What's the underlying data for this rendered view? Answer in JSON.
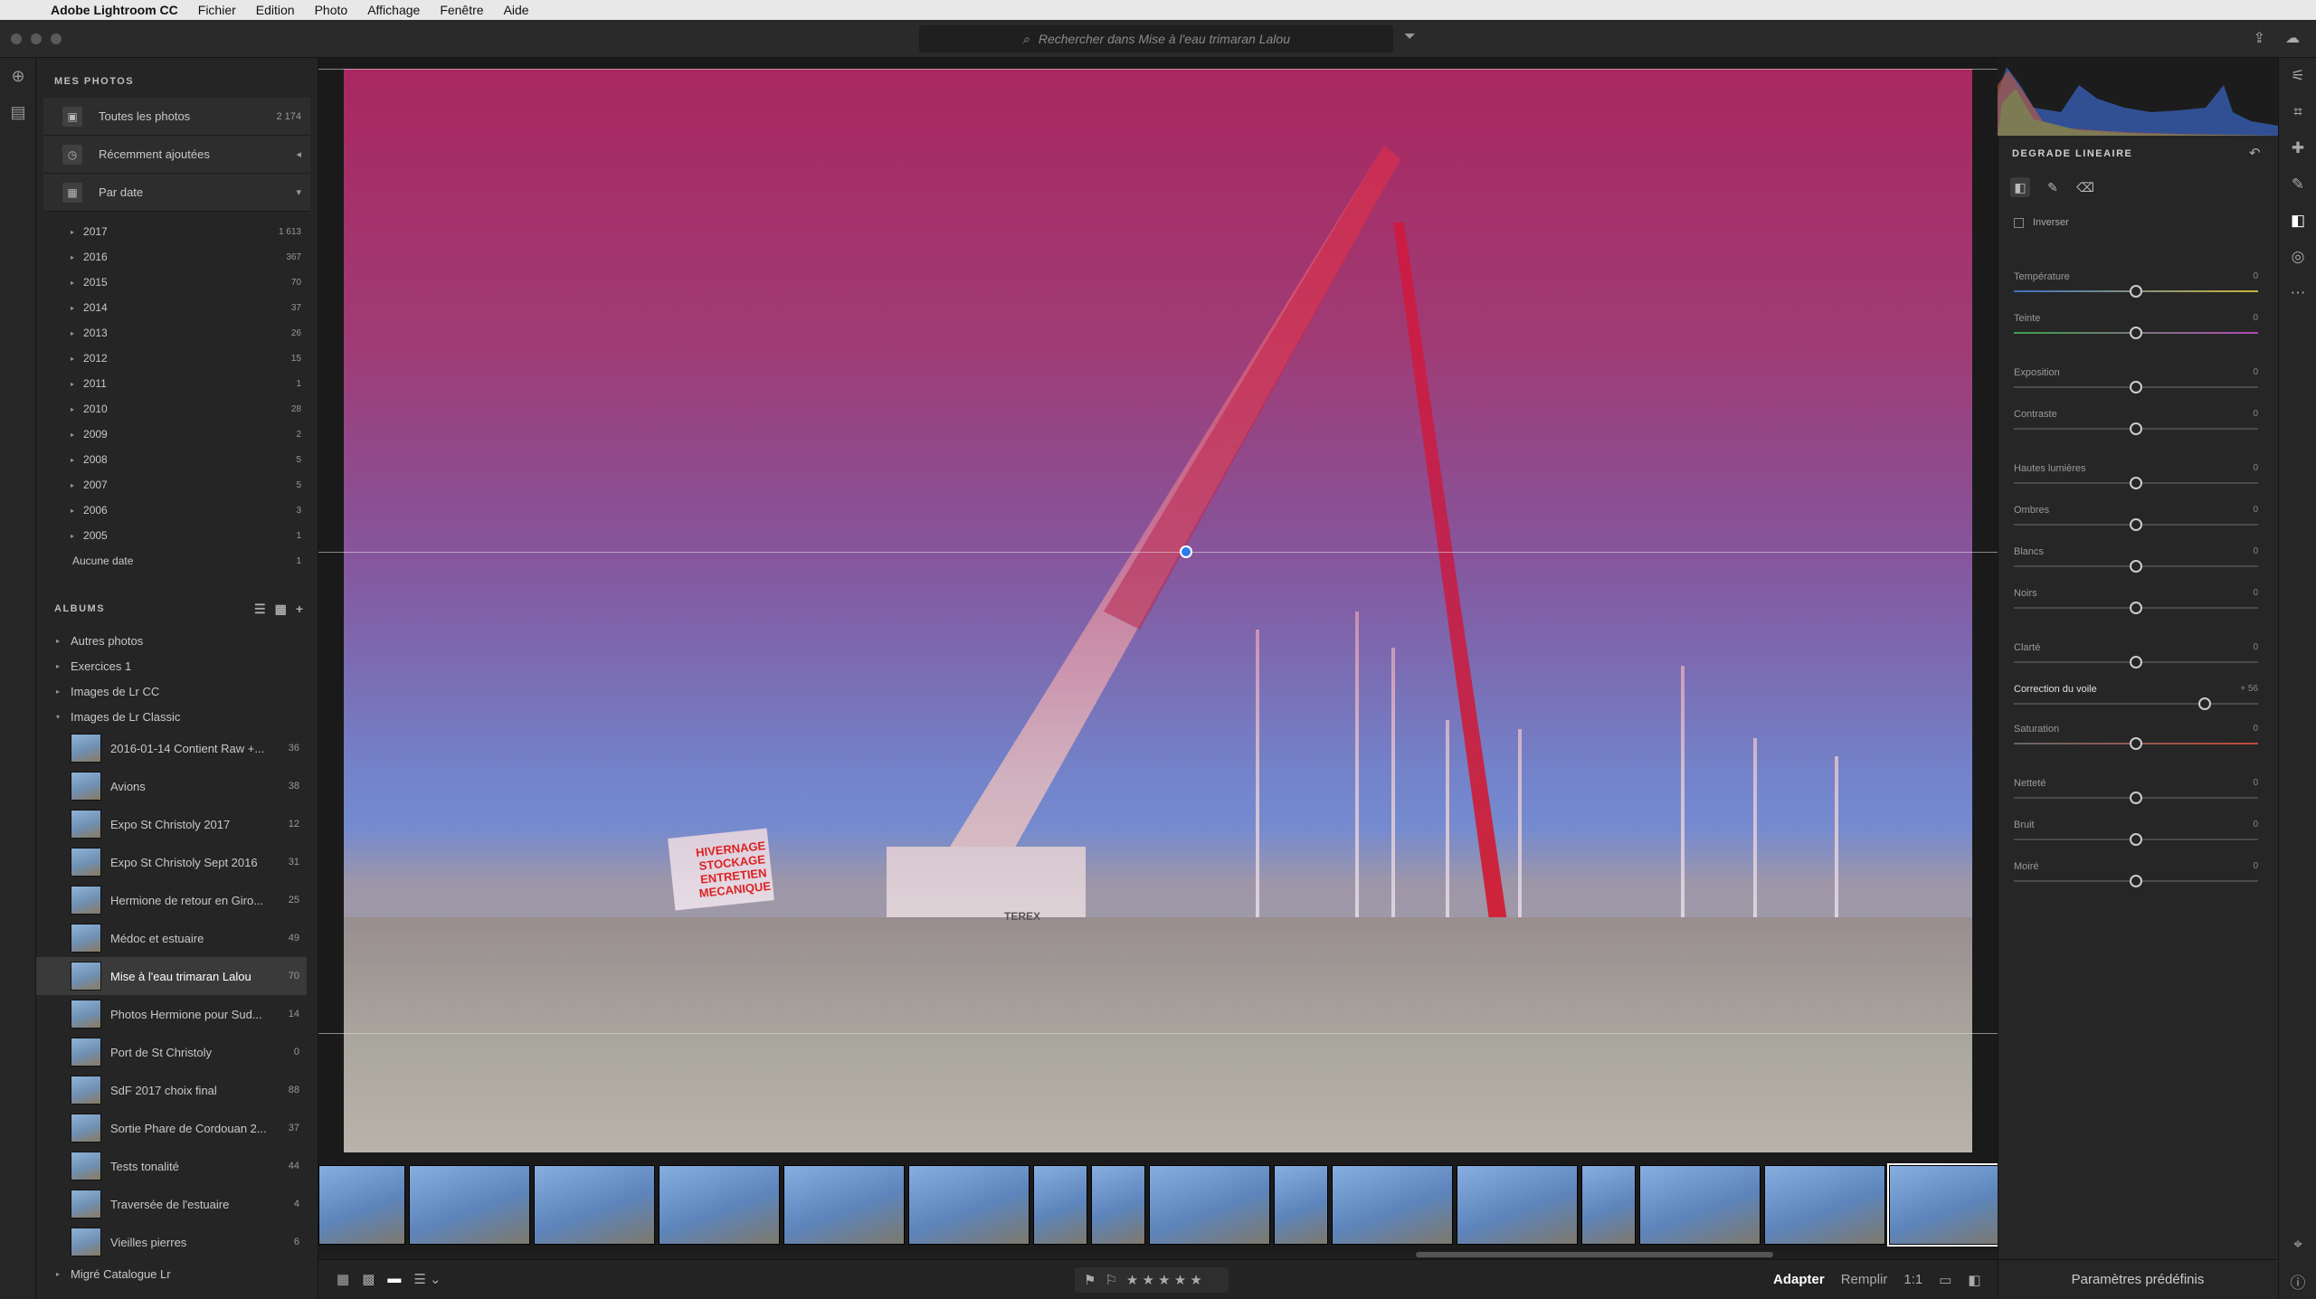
{
  "menubar": {
    "app": "Adobe Lightroom CC",
    "items": [
      "Fichier",
      "Edition",
      "Photo",
      "Affichage",
      "Fenêtre",
      "Aide"
    ]
  },
  "search": {
    "placeholder": "Rechercher dans Mise à l'eau trimaran Lalou"
  },
  "left": {
    "section_title": "MES PHOTOS",
    "top_items": [
      {
        "label": "Toutes les photos",
        "count": "2 174",
        "icon": "photos-icon"
      },
      {
        "label": "Récemment ajoutées",
        "count": "◂",
        "icon": "clock-icon"
      },
      {
        "label": "Par date",
        "count": "▾",
        "icon": "calendar-icon"
      }
    ],
    "years": [
      {
        "label": "2017",
        "count": "1 613"
      },
      {
        "label": "2016",
        "count": "367"
      },
      {
        "label": "2015",
        "count": "70"
      },
      {
        "label": "2014",
        "count": "37"
      },
      {
        "label": "2013",
        "count": "26"
      },
      {
        "label": "2012",
        "count": "15"
      },
      {
        "label": "2011",
        "count": "1"
      },
      {
        "label": "2010",
        "count": "28"
      },
      {
        "label": "2009",
        "count": "2"
      },
      {
        "label": "2008",
        "count": "5"
      },
      {
        "label": "2007",
        "count": "5"
      },
      {
        "label": "2006",
        "count": "3"
      },
      {
        "label": "2005",
        "count": "1"
      }
    ],
    "no_date": {
      "label": "Aucune date",
      "count": "1"
    },
    "albums_title": "ALBUMS",
    "groups": [
      "Autres photos",
      "Exercices 1",
      "Images de Lr CC",
      "Images de Lr Classic"
    ],
    "albums": [
      {
        "label": "2016-01-14 Contient Raw +...",
        "count": "36"
      },
      {
        "label": "Avions",
        "count": "38"
      },
      {
        "label": "Expo St Christoly 2017",
        "count": "12"
      },
      {
        "label": "Expo St Christoly Sept 2016",
        "count": "31"
      },
      {
        "label": "Hermione de retour en Giro...",
        "count": "25"
      },
      {
        "label": "Médoc et estuaire",
        "count": "49"
      },
      {
        "label": "Mise à l'eau trimaran Lalou",
        "count": "70"
      },
      {
        "label": "Photos Hermione pour Sud...",
        "count": "14"
      },
      {
        "label": "Port de St Christoly",
        "count": "0"
      },
      {
        "label": "SdF 2017 choix final",
        "count": "88"
      },
      {
        "label": "Sortie Phare de Cordouan 2...",
        "count": "37"
      },
      {
        "label": "Tests tonalité",
        "count": "44"
      },
      {
        "label": "Traversée de l'estuaire",
        "count": "4"
      },
      {
        "label": "Vieilles pierres",
        "count": "6"
      }
    ],
    "last_group": "Migré Catalogue Lr"
  },
  "photo_signs": {
    "sign_text": "HIVERNAGE STOCKAGE ENTRETIEN MECANIQUE",
    "crane_brand": "TEREX"
  },
  "bottom": {
    "fit": "Adapter",
    "fill": "Remplir",
    "one_to_one": "1:1",
    "stars": "★ ★ ★ ★ ★"
  },
  "panel": {
    "title": "DEGRADE LINEAIRE",
    "invert": "Inverser",
    "sliders": [
      {
        "label": "Température",
        "value": "0",
        "pos": 0.5
      },
      {
        "label": "Teinte",
        "value": "0",
        "pos": 0.5
      },
      {
        "label": "Exposition",
        "value": "0",
        "pos": 0.5
      },
      {
        "label": "Contraste",
        "value": "0",
        "pos": 0.5
      },
      {
        "label": "Hautes lumières",
        "value": "0",
        "pos": 0.5
      },
      {
        "label": "Ombres",
        "value": "0",
        "pos": 0.5
      },
      {
        "label": "Blancs",
        "value": "0",
        "pos": 0.5
      },
      {
        "label": "Noirs",
        "value": "0",
        "pos": 0.5
      },
      {
        "label": "Clarté",
        "value": "0",
        "pos": 0.5
      },
      {
        "label": "Correction du voile",
        "value": "+ 56",
        "pos": 0.78
      },
      {
        "label": "Saturation",
        "value": "0",
        "pos": 0.5
      },
      {
        "label": "Netteté",
        "value": "0",
        "pos": 0.5
      },
      {
        "label": "Bruit",
        "value": "0",
        "pos": 0.5
      },
      {
        "label": "Moiré",
        "value": "0",
        "pos": 0.5
      }
    ],
    "presets": "Paramètres prédéfinis"
  },
  "colors": {
    "accent": "#2d7cf0",
    "mask": "#c8144a"
  }
}
